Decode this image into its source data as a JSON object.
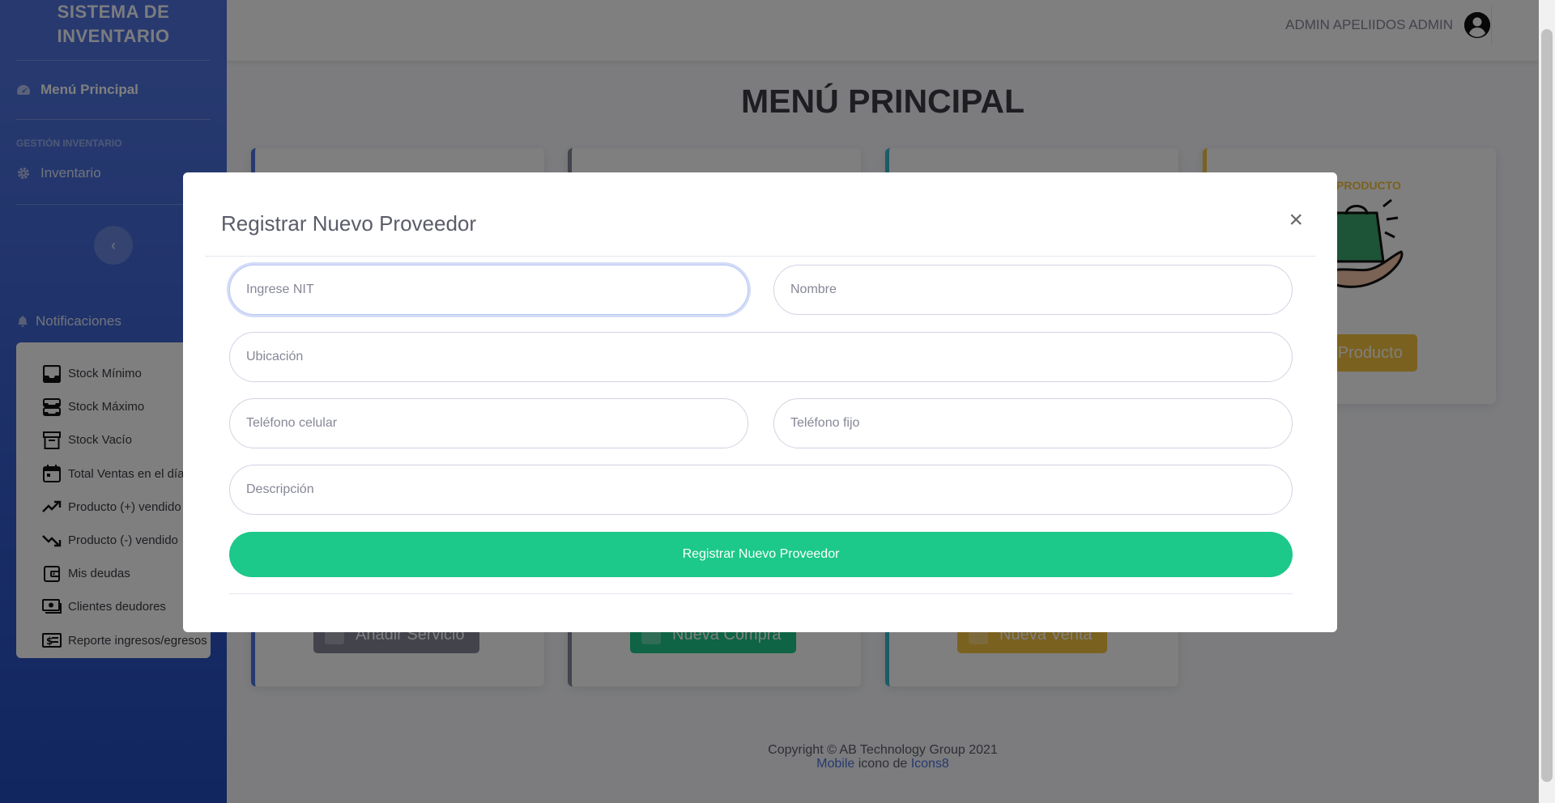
{
  "sidebar": {
    "brand_line1": "SISTEMA DE",
    "brand_line2": "INVENTARIO",
    "menu_principal": "Menú Principal",
    "heading": "GESTIÓN INVENTARIO",
    "inventario": "Inventario",
    "toggle_icon": "‹",
    "notificaciones": "Notificaciones",
    "items": [
      {
        "label": "Stock Mínimo",
        "icon": "inbox-icon"
      },
      {
        "label": "Stock Máximo",
        "icon": "inboxes-icon"
      },
      {
        "label": "Stock Vacío",
        "icon": "archive-icon"
      },
      {
        "label": "Total Ventas en el día",
        "icon": "calendar-icon"
      },
      {
        "label": "Producto (+) vendido",
        "icon": "trend-up-icon"
      },
      {
        "label": "Producto (-) vendido",
        "icon": "trend-down-icon"
      },
      {
        "label": "Mis deudas",
        "icon": "wallet-icon"
      },
      {
        "label": "Clientes deudores",
        "icon": "cash-icon"
      },
      {
        "label": "Reporte ingresos/egresos",
        "icon": "cash-report-icon"
      }
    ]
  },
  "topbar": {
    "user_name": "ADMIN APELIIDOS ADMIN"
  },
  "main": {
    "title": "MENÚ PRINCIPAL",
    "card4_label": "PRODUCTO",
    "btn_anadir_producto": "dir Producto",
    "btn_anadir_servicio": "Añadir Servicio",
    "btn_nueva_compra": "Nueva Compra",
    "btn_nueva_venta": "Nueva Venta"
  },
  "footer": {
    "copyright": "Copyright © AB Technology Group 2021",
    "mobile_link": "Mobile",
    "icono_de": " icono de ",
    "icons8_link": "Icons8"
  },
  "modal": {
    "title": "Registrar Nuevo Proveedor",
    "close": "×",
    "nit_placeholder": "Ingrese NIT",
    "nombre_placeholder": "Nombre",
    "ubicacion_placeholder": "Ubicación",
    "celular_placeholder": "Teléfono celular",
    "fijo_placeholder": "Teléfono fijo",
    "descripcion_placeholder": "Descripción",
    "submit_label": "Registrar Nuevo Proveedor"
  },
  "colors": {
    "primary": "#4e73df",
    "success": "#1cc88a",
    "warning": "#f6c23e",
    "secondary": "#858796"
  }
}
